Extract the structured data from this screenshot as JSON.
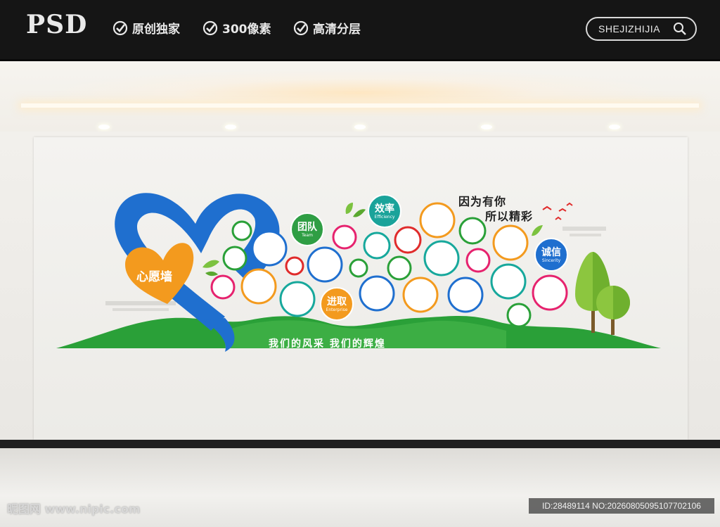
{
  "header": {
    "logo_text": "PSD",
    "features": [
      "原创独家",
      "300像素",
      "高清分层"
    ],
    "search_text": "SHEJIZHIJIA"
  },
  "mural": {
    "heart_label": "心愿墙",
    "slogan": "我们的风采  我们的辉煌",
    "quote_line1": "因为有你",
    "quote_line2": "所以精彩",
    "badges": [
      {
        "title": "团队",
        "subtitle": "Team",
        "color": "#2f9e44"
      },
      {
        "title": "效率",
        "subtitle": "Efficiency",
        "color": "#1aa39a"
      },
      {
        "title": "诚信",
        "subtitle": "Sincerity",
        "color": "#1f6fcf"
      },
      {
        "title": "进取",
        "subtitle": "Enterprise",
        "color": "#f39a1e"
      }
    ],
    "colors": {
      "blue": "#1f6fcf",
      "green": "#2aa038",
      "orange": "#f39a1e",
      "pink": "#e6226e",
      "teal": "#17a89c",
      "red": "#e02b2b"
    }
  },
  "watermark": {
    "left_text": "昵图网 www.nipic.com",
    "right_text": "ID:28489114 NO:20260805095107702106"
  }
}
